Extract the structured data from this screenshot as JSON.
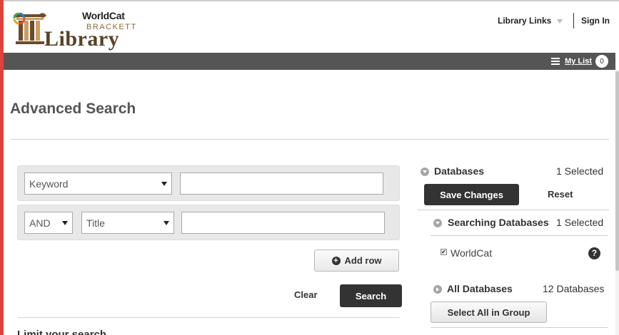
{
  "header": {
    "worldcat_text": "WorldCat",
    "brackett_text": "BRACKETT",
    "library_text": "Library",
    "library_links": "Library Links",
    "sign_in": "Sign In"
  },
  "topbar": {
    "my_list_label": "My List",
    "my_list_count": "0"
  },
  "page_title": "Advanced Search",
  "search": {
    "row1": {
      "field_select": "Keyword",
      "term_value": ""
    },
    "row2": {
      "operator_select": "AND",
      "field_select": "Title",
      "term_value": ""
    },
    "add_row_label": "Add row",
    "clear_label": "Clear",
    "search_label": "Search",
    "limit_heading": "Limit your search"
  },
  "databases": {
    "heading": "Databases",
    "selected_count": "1 Selected",
    "save_label": "Save Changes",
    "reset_label": "Reset",
    "searching_heading": "Searching Databases",
    "searching_count": "1 Selected",
    "items": [
      {
        "label": "WorldCat",
        "checked": true
      }
    ],
    "all_heading": "All Databases",
    "all_count": "12 Databases",
    "select_all_label": "Select All in Group"
  },
  "colors": {
    "accent_red": "#d9443f",
    "topbar": "#555555",
    "dark_button": "#333333",
    "brand_brown": "#5a4128"
  },
  "icons": [
    "library-column-logo-icon",
    "worldcat-logo-icon",
    "chevron-down-icon",
    "list-icon",
    "plus-circle-icon",
    "circle-chevron-down-icon",
    "circle-chevron-right-icon",
    "checkbox-icon",
    "help-icon"
  ]
}
